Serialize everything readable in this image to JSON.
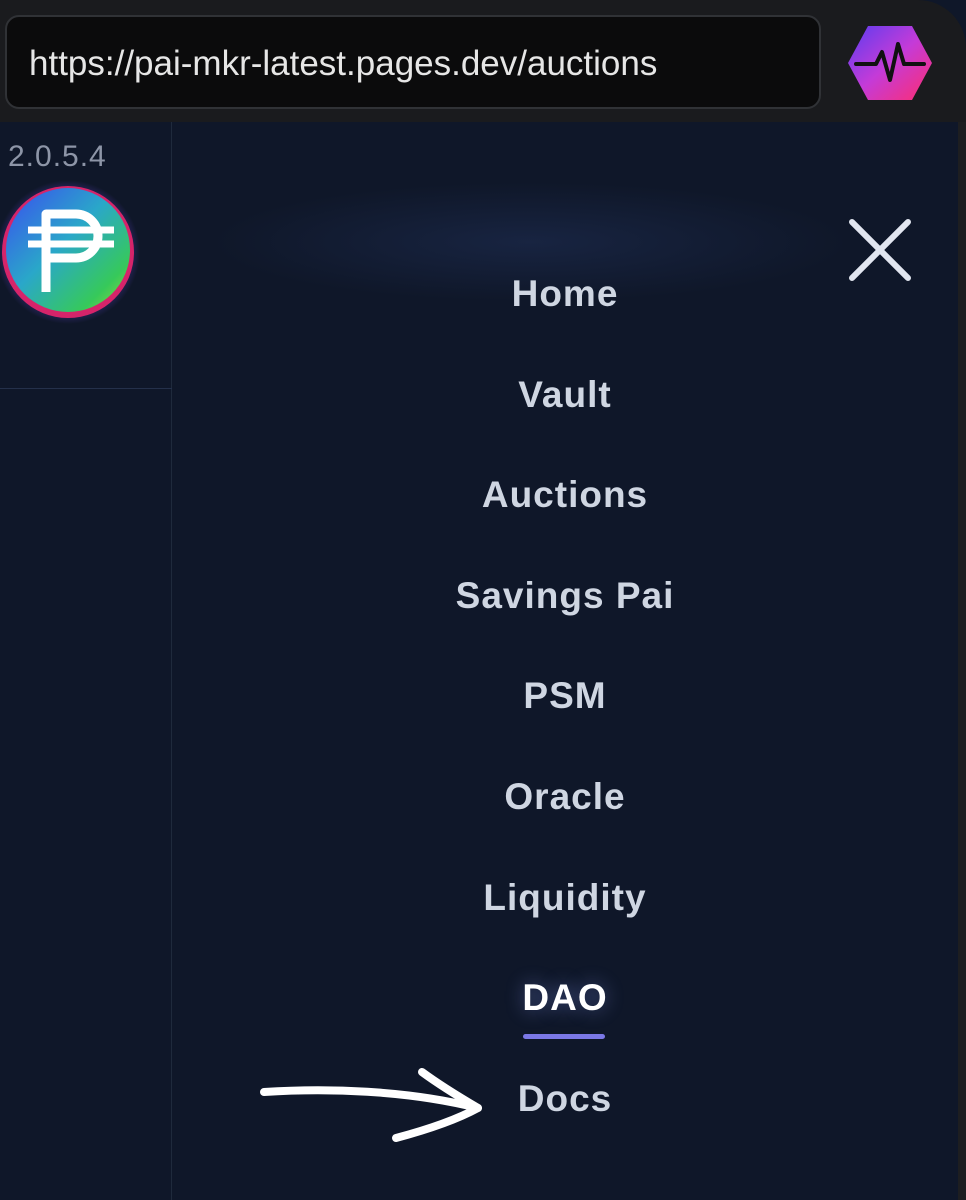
{
  "browser": {
    "url": "https://pai-mkr-latest.pages.dev/auctions",
    "extension_icon": "pulse-hexagon-icon"
  },
  "app": {
    "version": "2.0.5.4",
    "logo_icon": "pai-currency-logo",
    "close_icon": "close-icon"
  },
  "nav": {
    "items": [
      {
        "label": "Home"
      },
      {
        "label": "Vault"
      },
      {
        "label": "Auctions"
      },
      {
        "label": "Savings Pai"
      },
      {
        "label": "PSM"
      },
      {
        "label": "Oracle"
      },
      {
        "label": "Liquidity"
      },
      {
        "label": "DAO",
        "active": true
      },
      {
        "label": "Docs"
      }
    ]
  },
  "annotation": {
    "arrow_icon": "hand-drawn-arrow-icon"
  },
  "colors": {
    "background": "#0f1729",
    "menu_text": "#cfd6e2",
    "active_underline": "#7b78e6",
    "browser_bar": "#1a1b1e"
  }
}
